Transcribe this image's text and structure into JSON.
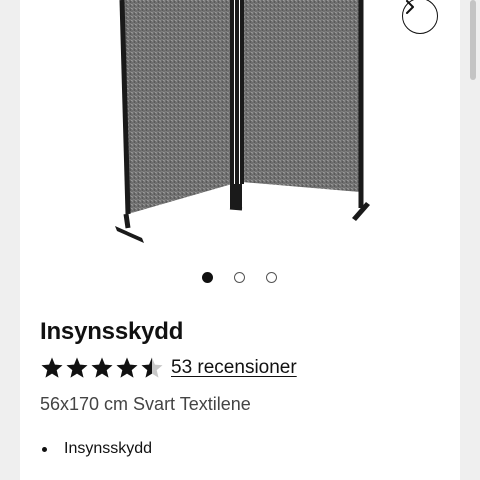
{
  "product": {
    "title": "Insynsskydd",
    "rating": 4.5,
    "rating_max": 5,
    "reviews_link": "53 recensioner",
    "subtitle": "56x170 cm Svart Textilene",
    "highlights": [
      "Insynsskydd"
    ]
  },
  "gallery": {
    "image_count": 3,
    "active_index": 0,
    "next_icon": "chevron-right-icon"
  },
  "colors": {
    "star": "#111111",
    "star_empty": "#c8c8c8",
    "page_bg": "#ffffff",
    "outer_bg": "#efefef"
  }
}
